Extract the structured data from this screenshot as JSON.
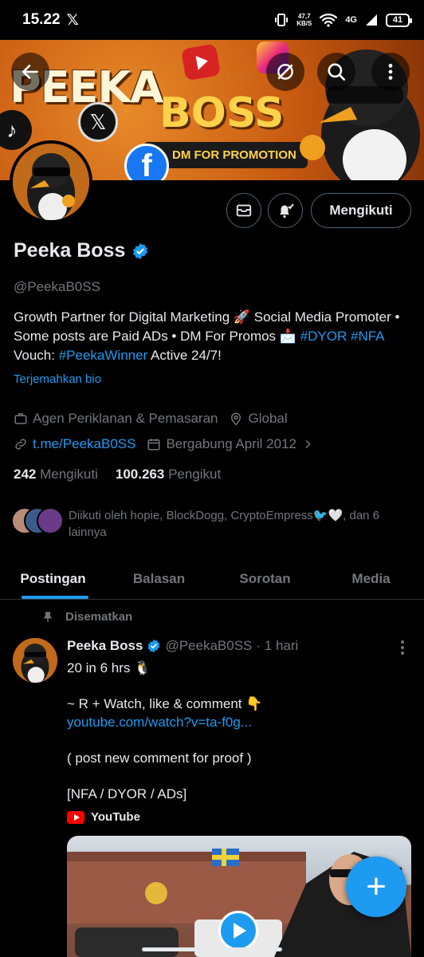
{
  "status_bar": {
    "time": "15.22",
    "x_logo": "𝕏",
    "net_speed_top": "47,7",
    "net_speed_unit": "KB/S",
    "network": "4G",
    "battery": "41"
  },
  "banner": {
    "title_line1": "PEEKA",
    "title_line2": "BOSS",
    "promo": "DM FOR PROMOTION",
    "back_icon": "arrow-left-icon",
    "grok_icon": "grok-icon",
    "search_icon": "search-icon",
    "more_icon": "more-vertical-icon"
  },
  "actions": {
    "message_icon": "mail-icon",
    "notify_icon": "bell-check-icon",
    "follow_label": "Mengikuti"
  },
  "profile": {
    "name": "Peeka Boss",
    "handle": "@PeekaB0SS",
    "bio_text1": "Growth Partner for Digital Marketing 🚀 Social Media Promoter • Some posts are Paid ADs • DM For Promos 📩 ",
    "bio_tag1": "#DYOR",
    "bio_tag2": "#NFA",
    "bio_text2": "Vouch: ",
    "bio_tag3": "#PeekaWinner",
    "bio_text3": " Active 24/7!",
    "translate": "Terjemahkan bio",
    "category": "Agen Periklanan & Pemasaran",
    "location": "Global",
    "link": "t.me/PeekaB0SS",
    "joined": "Bergabung April 2012",
    "following_count": "242",
    "following_label": "Mengikuti",
    "followers_count": "100.263",
    "followers_label": "Pengikut",
    "followed_by": "Diikuti oleh hopie, BlockDogg, CryptoEmpress🐦🤍, dan 6 lainnya"
  },
  "tabs": [
    {
      "label": "Postingan"
    },
    {
      "label": "Balasan"
    },
    {
      "label": "Sorotan"
    },
    {
      "label": "Media"
    }
  ],
  "post": {
    "pinned_label": "Disematkan",
    "name": "Peeka Boss",
    "handle": "@PeekaB0SS",
    "time": "· 1 hari",
    "line1": "20  in 6 hrs 🐧",
    "line2": "~ R +  Watch, like & comment 👇",
    "link": "youtube.com/watch?v=ta-f0g...",
    "line3": "( post new comment for proof )",
    "line4": "[NFA / DYOR / ADs]",
    "card_source": "YouTube"
  },
  "fab_label": "+",
  "colors": {
    "accent": "#1d9bf0",
    "background": "#000000",
    "text_primary": "#e7e9ea",
    "text_secondary": "#71767b"
  }
}
